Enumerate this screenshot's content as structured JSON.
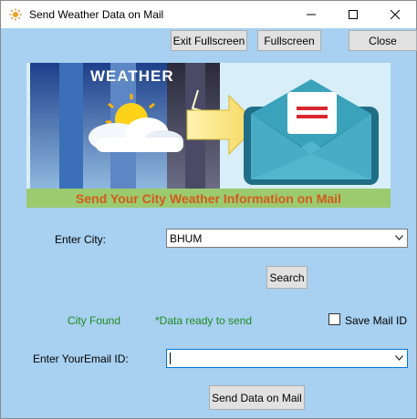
{
  "window": {
    "title": "Send Weather Data on Mail"
  },
  "toolbar": {
    "exit_fullscreen_label": "Exit Fullscreen",
    "fullscreen_label": "Fullscreen",
    "close_label": "Close"
  },
  "banner": {
    "weather_text": "WEATHER",
    "caption": "Send Your City Weather Information on Mail"
  },
  "form": {
    "city_label": "Enter City:",
    "city_value": "BHUM",
    "search_label": "Search",
    "status_found": "City Found",
    "status_ready": "*Data ready to send",
    "save_mail_label": "Save Mail ID",
    "save_mail_checked": false,
    "email_label": "Enter YourEmail ID:",
    "email_value": "",
    "send_label": "Send Data on Mail"
  },
  "colors": {
    "window_background": "#a8d0f0",
    "status_text": "#1f8a1f",
    "banner_caption_text": "#d35b1c",
    "banner_caption_background": "#9bca6f",
    "focus_border": "#0078d7"
  },
  "icons": {
    "app": "sun-icon",
    "minimize": "minimize-icon",
    "maximize": "maximize-icon",
    "close": "close-icon",
    "dropdown": "chevron-down-icon",
    "banner_weather": "sun-cloud-icon",
    "banner_arrow": "arrow-right-icon",
    "banner_mail": "envelope-icon"
  }
}
